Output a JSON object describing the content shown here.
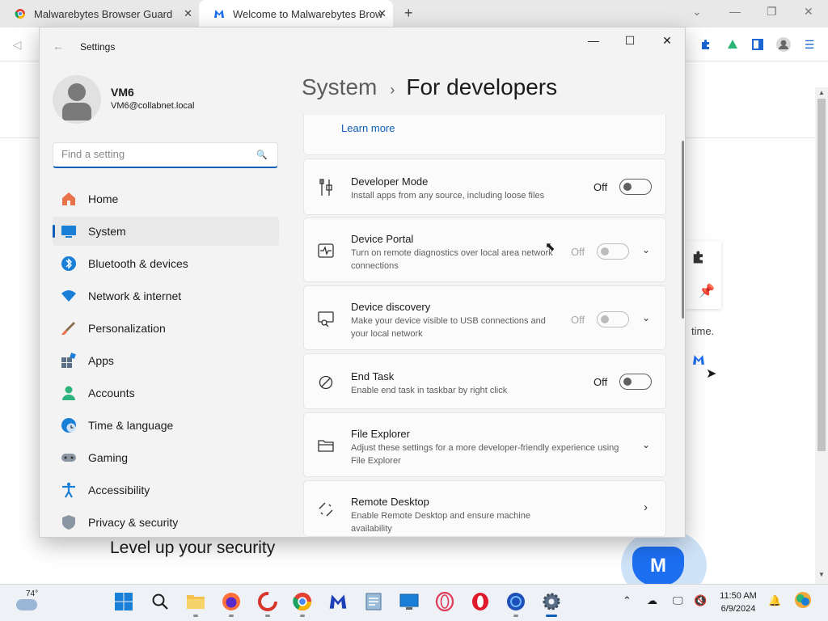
{
  "browser": {
    "tabs": [
      {
        "label": "Malwarebytes Browser Guard",
        "active": false
      },
      {
        "label": "Welcome to Malwarebytes Brow",
        "active": true
      }
    ],
    "new_tab_icon": "plus-icon",
    "page": {
      "time_text": "time.",
      "level_up_title": "Level up your security"
    }
  },
  "settings": {
    "window_title": "Settings",
    "profile": {
      "name": "VM6",
      "email": "VM6@collabnet.local"
    },
    "search": {
      "placeholder": "Find a setting"
    },
    "nav": [
      {
        "label": "Home",
        "icon": "home-icon",
        "selected": false
      },
      {
        "label": "System",
        "icon": "system-icon",
        "selected": true
      },
      {
        "label": "Bluetooth & devices",
        "icon": "bluetooth-icon",
        "selected": false
      },
      {
        "label": "Network & internet",
        "icon": "wifi-icon",
        "selected": false
      },
      {
        "label": "Personalization",
        "icon": "brush-icon",
        "selected": false
      },
      {
        "label": "Apps",
        "icon": "apps-icon",
        "selected": false
      },
      {
        "label": "Accounts",
        "icon": "accounts-icon",
        "selected": false
      },
      {
        "label": "Time & language",
        "icon": "globe-clock-icon",
        "selected": false
      },
      {
        "label": "Gaming",
        "icon": "gamepad-icon",
        "selected": false
      },
      {
        "label": "Accessibility",
        "icon": "accessibility-icon",
        "selected": false
      },
      {
        "label": "Privacy & security",
        "icon": "shield-icon",
        "selected": false
      }
    ],
    "breadcrumb": {
      "parent": "System",
      "separator": "›",
      "current": "For developers"
    },
    "learn_more": "Learn more",
    "cards": [
      {
        "title": "Developer Mode",
        "desc": "Install apps from any source, including loose files",
        "state": "Off",
        "enabled": true,
        "expand": false
      },
      {
        "title": "Device Portal",
        "desc": "Turn on remote diagnostics over local area network connections",
        "state": "Off",
        "enabled": false,
        "expand": true
      },
      {
        "title": "Device discovery",
        "desc": "Make your device visible to USB connections and your local network",
        "state": "Off",
        "enabled": false,
        "expand": true
      },
      {
        "title": "End Task",
        "desc": "Enable end task in taskbar by right click",
        "state": "Off",
        "enabled": true,
        "expand": false
      },
      {
        "title": "File Explorer",
        "desc": "Adjust these settings for a more developer-friendly experience using File Explorer",
        "state": "",
        "enabled": true,
        "expand": true
      },
      {
        "title": "Remote Desktop",
        "desc": "Enable Remote Desktop and ensure machine availability",
        "state": "",
        "enabled": true,
        "expand": false
      }
    ]
  },
  "taskbar": {
    "weather_temp": "74°",
    "clock_time": "11:50 AM",
    "clock_date": "6/9/2024"
  },
  "colors": {
    "accent": "#0f5fb8",
    "malwarebytes_blue": "#1d6ff2"
  }
}
